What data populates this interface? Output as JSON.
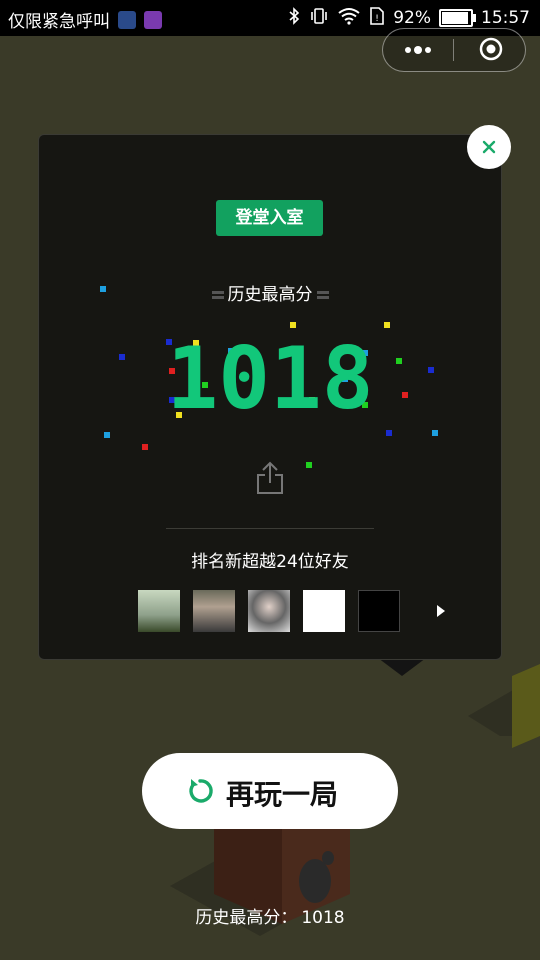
{
  "status_bar": {
    "carrier_text": "仅限紧急呼叫",
    "battery_percent": "92%",
    "battery_level": 0.92,
    "time": "15:57",
    "icons": [
      "bluetooth-icon",
      "vibrate-icon",
      "wifi-icon",
      "sim-icon",
      "battery-icon"
    ]
  },
  "capsule": {
    "menu_icon": "more-dots-icon",
    "close_icon": "target-circle-icon"
  },
  "panel": {
    "badge": "登堂入室",
    "history_label": "历史最高分",
    "score": "1018",
    "share_icon": "share-icon",
    "rank_text": "排名新超越24位好友",
    "close_icon": "close-icon",
    "more_icon": "play-arrow-icon"
  },
  "replay_button": {
    "label": "再玩一局",
    "icon": "replay-icon"
  },
  "footer": {
    "label": "历史最高分：",
    "value": "1018"
  },
  "colors": {
    "score_green": "#12c77a",
    "badge_green": "#12a15f",
    "accent_green": "#1aaa6a",
    "background": "#3a3a28",
    "panel_bg": "#161612"
  }
}
